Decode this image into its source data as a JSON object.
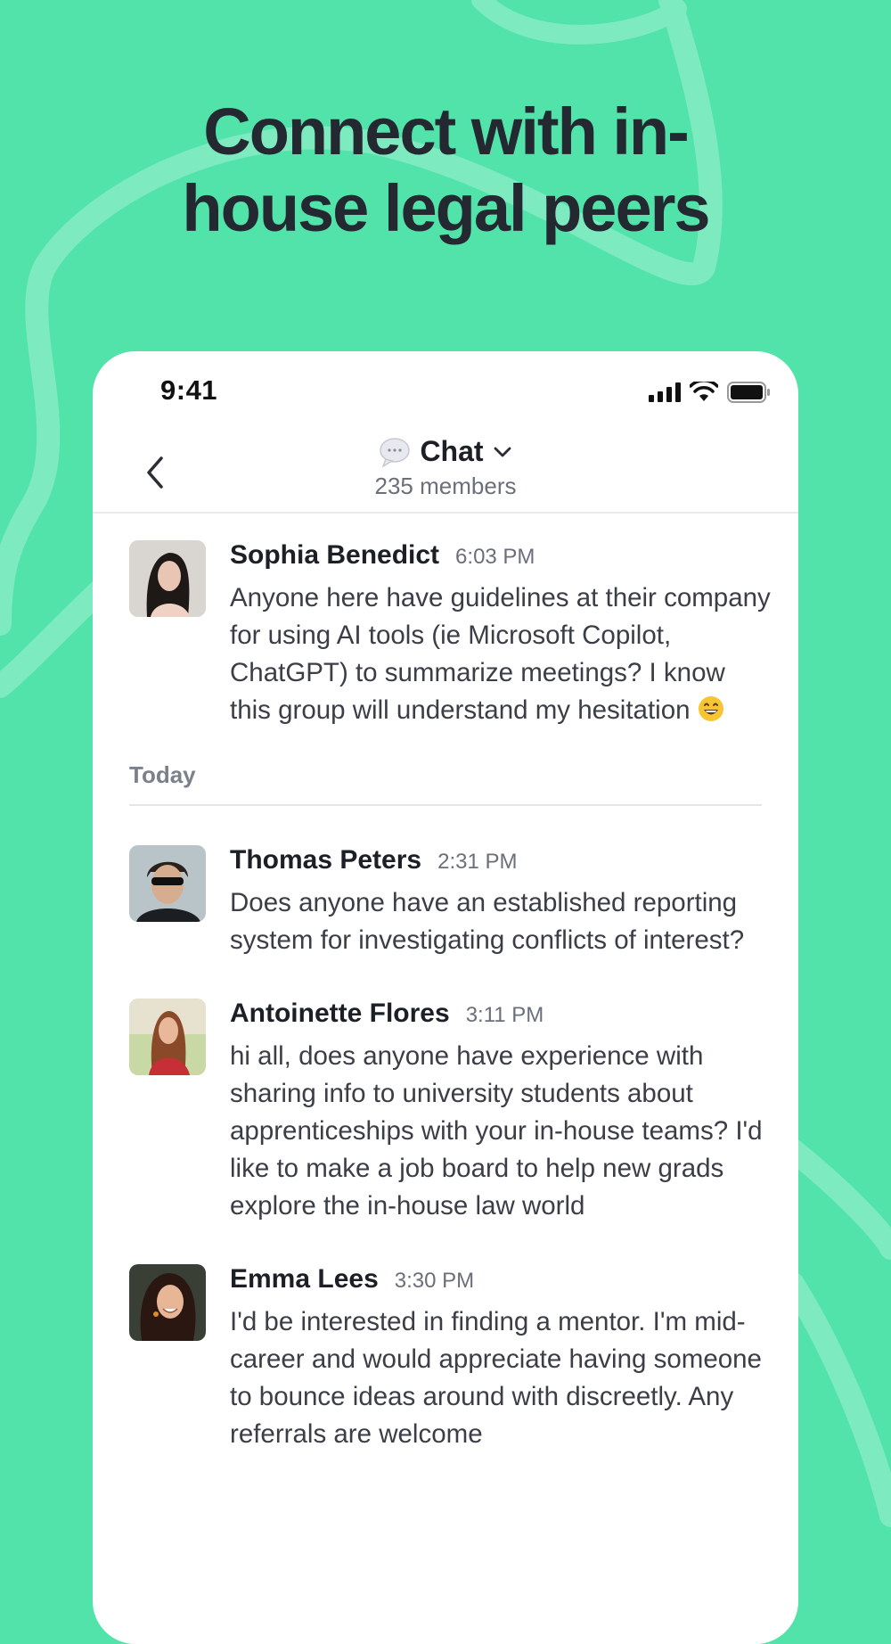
{
  "headline": "Connect with in-\nhouse legal peers",
  "status": {
    "time": "9:41",
    "icons": [
      "cellular-signal-icon",
      "wifi-icon",
      "battery-icon"
    ]
  },
  "header": {
    "title": "Chat",
    "title_icon": "speech-bubble-icon",
    "dropdown_icon": "chevron-down-icon",
    "subtitle": "235 members",
    "back_icon": "back-chevron-icon"
  },
  "messages": [
    {
      "name": "Sophia Benedict",
      "time": "6:03 PM",
      "text": "Anyone here have guidelines at their company for using AI tools (ie Microsoft Copilot, ChatGPT) to summarize meetings? I know this group will understand my hesitation",
      "emoji": "grinning-face-icon"
    },
    {
      "divider": "Today"
    },
    {
      "name": "Thomas Peters",
      "time": "2:31 PM",
      "text": "Does anyone have an established reporting system for investigating conflicts of interest?"
    },
    {
      "name": "Antoinette Flores",
      "time": "3:11 PM",
      "text": "hi all, does anyone have experience with sharing info to university students about apprenticeships with your in-house teams? I'd like to make a job board to help new grads explore the in-house law world"
    },
    {
      "name": "Emma Lees",
      "time": "3:30 PM",
      "text": "I'd be interested in finding a mentor. I'm mid-career and would appreciate having someone to bounce ideas around with discreetly. Any referrals are welcome"
    }
  ],
  "colors": {
    "background": "#51e3a9",
    "swirl": "#7deac0",
    "headline": "#242830",
    "card": "#ffffff"
  }
}
